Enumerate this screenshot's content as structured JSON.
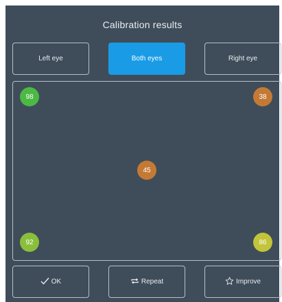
{
  "title": "Calibration results",
  "tabs": {
    "left": "Left eye",
    "both": "Both eyes",
    "right": "Right eye"
  },
  "points": {
    "top_left": {
      "value": "98",
      "color": "#4cb944"
    },
    "top_right": {
      "value": "38",
      "color": "#c47a35"
    },
    "center": {
      "value": "45",
      "color": "#c47a35"
    },
    "bottom_left": {
      "value": "92",
      "color": "#8abf3c"
    },
    "bottom_right": {
      "value": "86",
      "color": "#c2c43a"
    }
  },
  "footer": {
    "ok": "OK",
    "ok_icon": "check-icon",
    "repeat": "Repeat",
    "repeat_icon": "repeat-icon",
    "improve": "Improve",
    "improve_icon": "star-icon"
  }
}
